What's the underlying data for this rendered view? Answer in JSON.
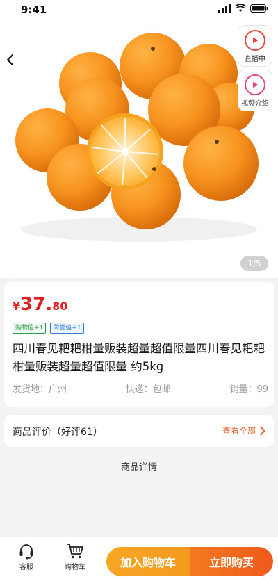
{
  "status_bar": {
    "time": "9:41"
  },
  "hero": {
    "live_label": "直播中",
    "video_label": "视频介绍",
    "image_counter": "1/5"
  },
  "product": {
    "price_currency": "¥",
    "price_integer": "37.",
    "price_decimal": "80",
    "tags": [
      "购物值+1",
      "荣誉值+1"
    ],
    "title": "四川春见耙耙柑量贩装超量超值限量四川春见耙耙柑量贩装超量超值限量 约5kg",
    "meta": {
      "origin": "发货地：广州",
      "shipping": "快递：包邮",
      "sales": "销量：99"
    }
  },
  "reviews": {
    "title": "商品评价（好评61）",
    "link": "查看全部"
  },
  "details": {
    "heading": "商品详情"
  },
  "bottom_bar": {
    "service_label": "客服",
    "cart_label": "购物车",
    "add_to_cart": "加入购物车",
    "buy_now": "立即购买"
  },
  "colors": {
    "price": "#e02020",
    "accent": "#e2622a",
    "cart_button": "#f6a623",
    "buy_button": "#ef5a1c"
  }
}
